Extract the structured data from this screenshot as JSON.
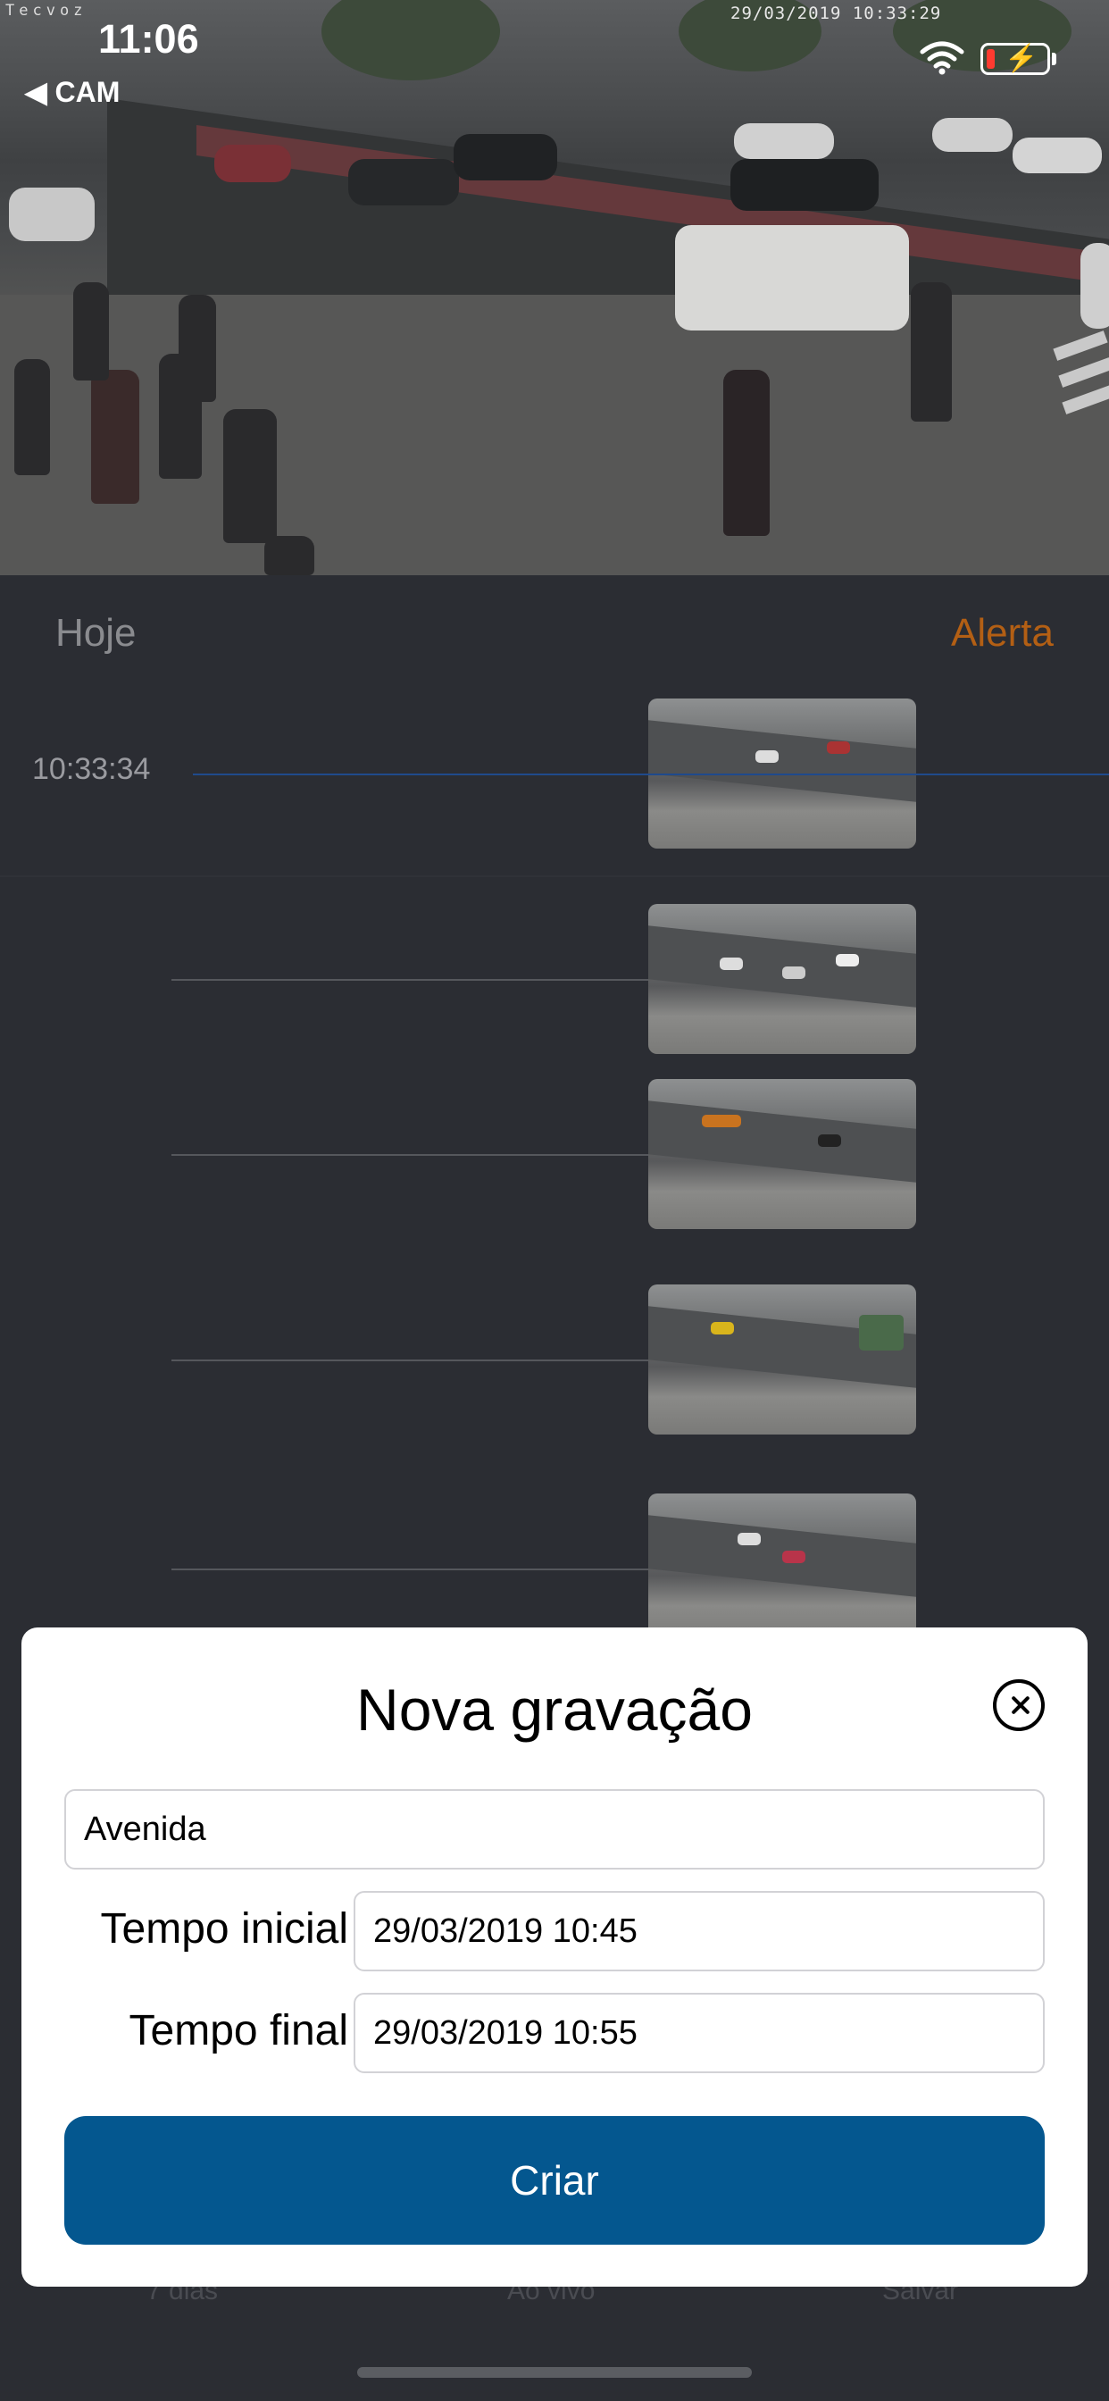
{
  "status_bar": {
    "time": "11:06",
    "back_label": "◀ CAM",
    "wifi_icon": "wifi-icon",
    "battery_icon": "battery-charging-icon",
    "battery_color": "#ff3b30"
  },
  "camera_feed": {
    "brand_overlay": "Tecvoz",
    "timestamp_overlay": "29/03/2019 10:33:29"
  },
  "header": {
    "today_label": "Hoje",
    "alert_label": "Alerta",
    "alert_color": "#b35f14"
  },
  "timeline": {
    "current_time": "10:33:34",
    "current_line_color": "#1f4a8c"
  },
  "bottom_tabs": {
    "days_label": "7 dias",
    "live_label": "Ao vivo",
    "save_label": "Salvar"
  },
  "modal": {
    "title": "Nova gravação",
    "close_icon": "close-circle-icon",
    "name_value": "Avenida",
    "start_label": "Tempo inicial",
    "start_value": "29/03/2019 10:45",
    "end_label": "Tempo final",
    "end_value": "29/03/2019 10:55",
    "create_label": "Criar",
    "create_color": "#04578f"
  }
}
